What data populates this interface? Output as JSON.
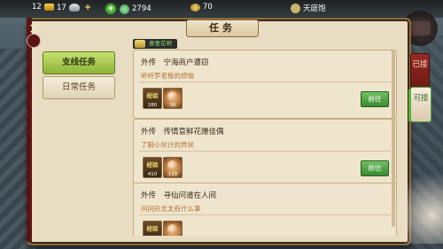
{
  "topbar": {
    "gold": "12",
    "silver": "17",
    "plus": "+",
    "jade": "2794",
    "stamina": "70",
    "location": "天庭饱"
  },
  "window": {
    "title": "任务",
    "close": "✕"
  },
  "tabs": [
    {
      "label": "支线任务",
      "active": true
    },
    {
      "label": "日常任务",
      "active": false
    }
  ],
  "badge": {
    "text": "惠妻花啊"
  },
  "quests": [
    {
      "title": "外传　宁海商户遭窃",
      "desc": "听听罗老板的烦恼",
      "exp_label": "经验",
      "exp": "280",
      "item": "56",
      "go": "前往"
    },
    {
      "title": "外传　传情意鲜花赠佳偶",
      "desc": "了解小伙计的异状",
      "exp_label": "经验",
      "exp": "410",
      "item": "139",
      "go": "前往"
    },
    {
      "title": "外传　寻仙问道在人间",
      "desc": "问问孙太太有什么事",
      "exp_label": "经验",
      "exp": "",
      "item": "",
      "go": ""
    }
  ],
  "side_tabs": {
    "done": "已接",
    "available": "可接"
  },
  "colors": {
    "accent_green": "#8eb23a",
    "header_red": "#7a1f1c",
    "desc_orange": "#b2702f"
  }
}
